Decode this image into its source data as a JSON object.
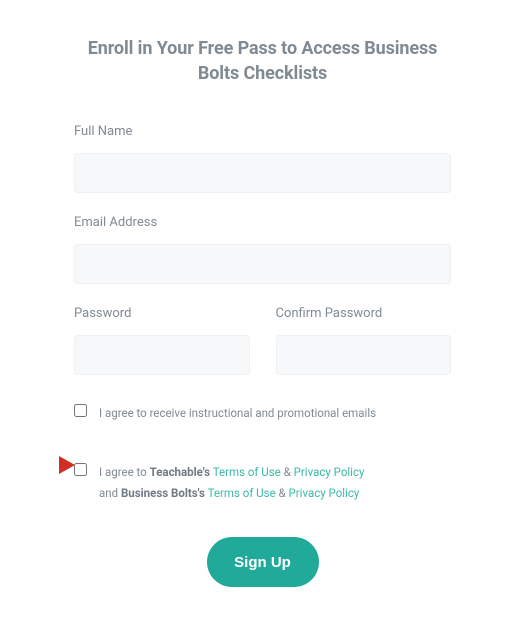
{
  "title": "Enroll in Your Free Pass to Access Business Bolts Checklists",
  "fields": {
    "full_name_label": "Full Name",
    "email_label": "Email Address",
    "password_label": "Password",
    "confirm_password_label": "Confirm Password"
  },
  "checkboxes": {
    "promo_text": "I agree to receive instructional and promotional emails",
    "terms_prefix": "I agree to ",
    "teachable_name": "Teachable's",
    "terms_of_use": "Terms of Use",
    "ampersand": " & ",
    "privacy_policy": "Privacy Policy",
    "and_word": "and ",
    "businessbolts_name": "Business Bolts's"
  },
  "button": {
    "signup_label": "Sign Up"
  },
  "colors": {
    "accent": "#21a99a",
    "label_gray": "#808a93",
    "link": "#3ab8aa",
    "arrow_red": "#d22f24"
  }
}
